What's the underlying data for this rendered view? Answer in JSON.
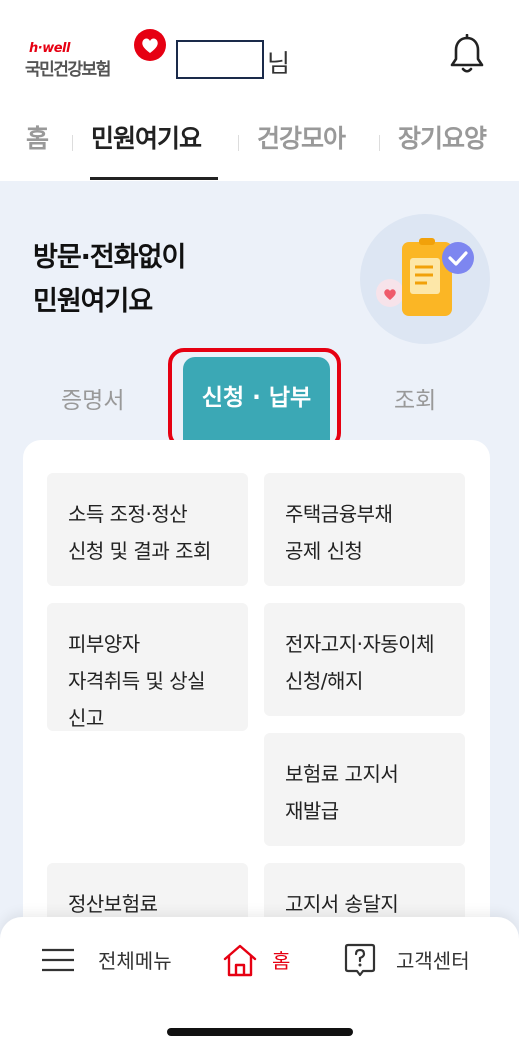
{
  "header": {
    "logo_tagline": "h·well",
    "logo_name": "국민건강보험",
    "user_suffix": "님",
    "notification_icon": "bell-icon"
  },
  "tabs": [
    {
      "label": "홈",
      "active": false
    },
    {
      "label": "민원여기요",
      "active": true
    },
    {
      "label": "건강모아",
      "active": false
    },
    {
      "label": "장기요양",
      "active": false
    }
  ],
  "hero": {
    "title_line1": "방문·전화없이",
    "title_line2": "민원여기요",
    "illustration": "document-check-icon"
  },
  "sub_tabs": [
    {
      "label": "증명서",
      "active": false
    },
    {
      "label": "신청 · 납부",
      "active": true
    },
    {
      "label": "조회",
      "active": false
    }
  ],
  "items": [
    {
      "line1": "소득 조정·정산",
      "line2": "신청 및 결과 조회"
    },
    {
      "line1": "주택금융부채",
      "line2": "공제 신청"
    },
    {
      "line1": "피부양자",
      "line2": "자격취득 및 상실",
      "line3": "신고"
    },
    {
      "line1": "전자고지·자동이체",
      "line2": "신청/해지"
    },
    {
      "line1": "보험료 고지서",
      "line2": "재발급"
    },
    {
      "line1": "정산보험료"
    },
    {
      "line1": "고지서 송달지"
    }
  ],
  "bottom_nav": [
    {
      "label": "전체메뉴",
      "icon": "menu-icon"
    },
    {
      "label": "홈",
      "icon": "home-icon"
    },
    {
      "label": "고객센터",
      "icon": "help-icon"
    }
  ],
  "colors": {
    "brand_red": "#e60012",
    "accent_teal": "#3ba8b5",
    "background": "#ecf1f9"
  }
}
